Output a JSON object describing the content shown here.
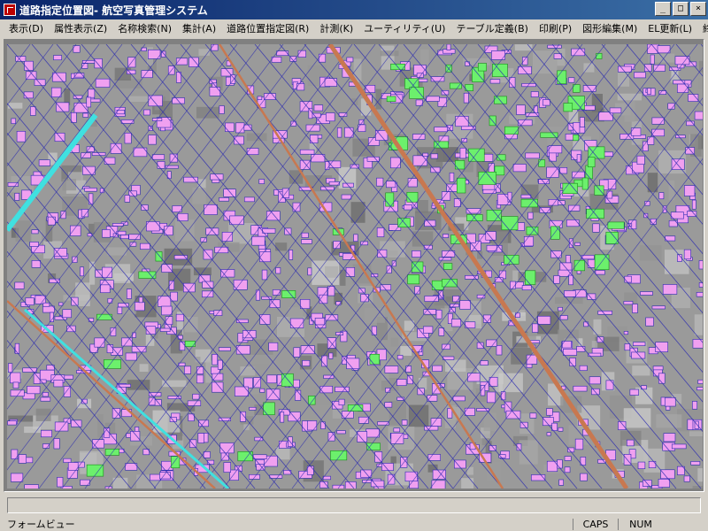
{
  "window": {
    "title": "道路指定位置図- 航空写真管理システム",
    "minimize": "_",
    "maximize": "□",
    "close": "×"
  },
  "menu": [
    "表示(D)",
    "属性表示(Z)",
    "名称検索(N)",
    "集計(A)",
    "道路位置指定図(R)",
    "計測(K)",
    "ユーティリティ(U)",
    "テーブル定義(B)",
    "印刷(P)",
    "図形編集(M)",
    "EL更新(L)",
    "終了(E)"
  ],
  "status": {
    "text": "フォームビュー",
    "caps": "CAPS",
    "num": "NUM"
  },
  "colors": {
    "building": "#f0a0f0",
    "road_line": "#2a2ab0",
    "park": "#6cf06c",
    "water": "#40e0e0",
    "rail": "#c87850"
  }
}
